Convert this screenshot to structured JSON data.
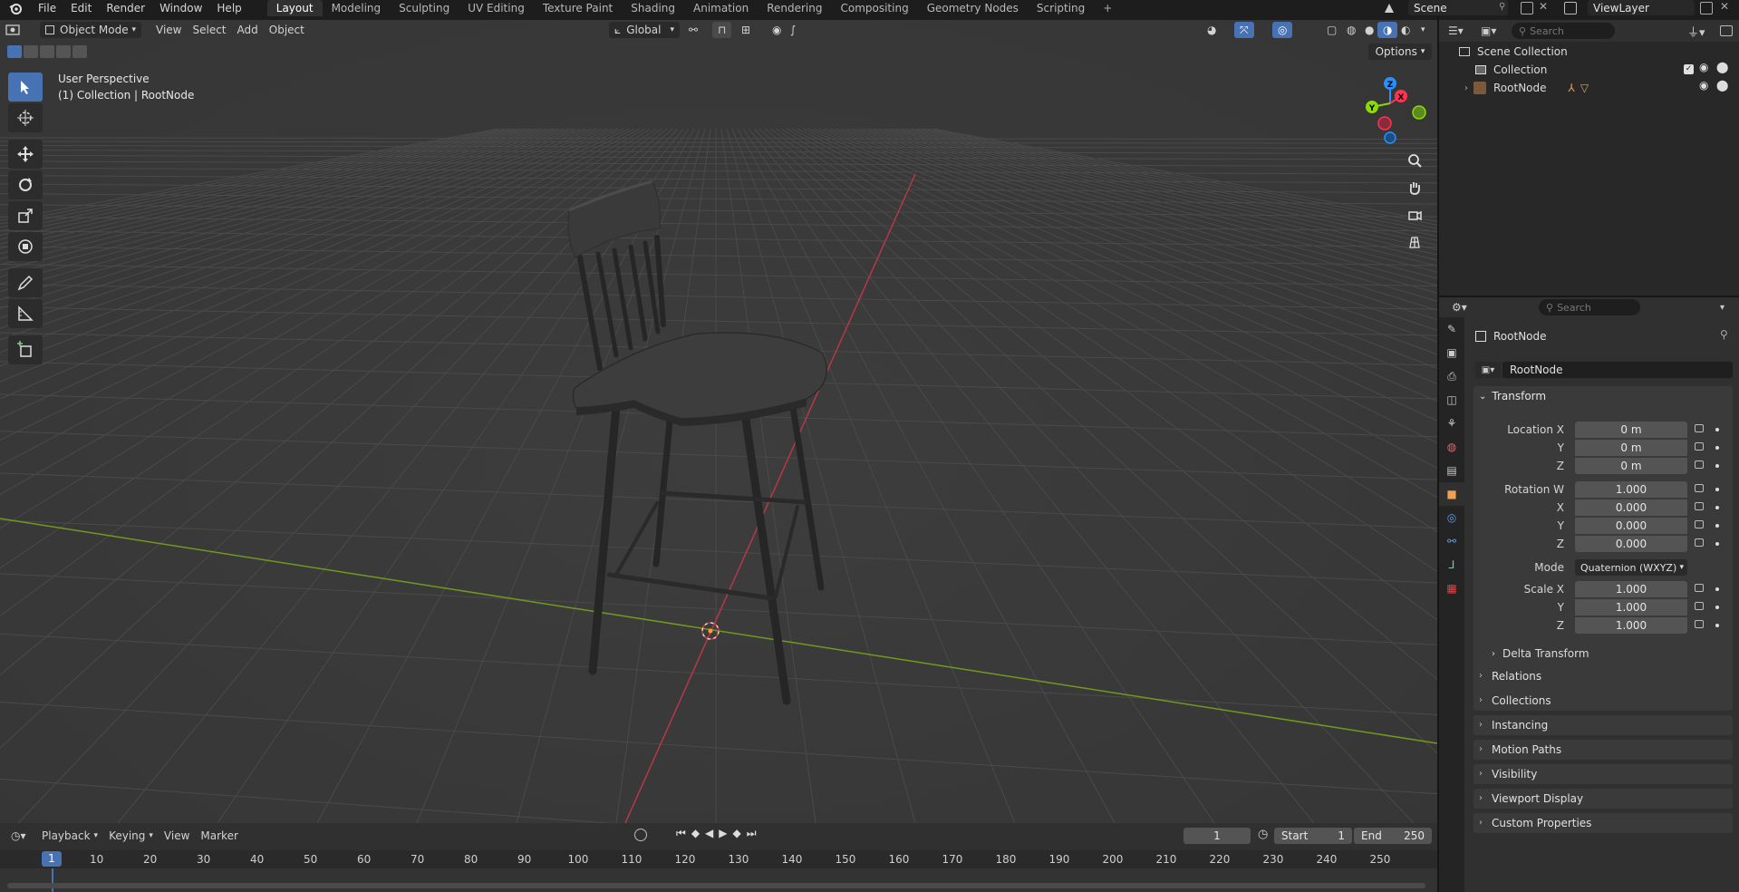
{
  "menu": [
    "File",
    "Edit",
    "Render",
    "Window",
    "Help"
  ],
  "workspaces": [
    "Layout",
    "Modeling",
    "Sculpting",
    "UV Editing",
    "Texture Paint",
    "Shading",
    "Animation",
    "Rendering",
    "Compositing",
    "Geometry Nodes",
    "Scripting",
    "+"
  ],
  "scene_name": "Scene",
  "view_layer_name": "ViewLayer",
  "viewport": {
    "mode": "Object Mode",
    "menus": [
      "View",
      "Select",
      "Add",
      "Object"
    ],
    "orientation": "Global",
    "options_label": "Options",
    "overlay_title": "User Perspective",
    "overlay_subtitle": "(1) Collection | RootNode",
    "gizmo_axes": {
      "x": "X",
      "y": "Y",
      "z": "Z"
    }
  },
  "outliner": {
    "search_placeholder": "Search",
    "rows": [
      {
        "label": "Scene Collection"
      },
      {
        "label": "Collection"
      },
      {
        "label": "RootNode"
      }
    ]
  },
  "properties": {
    "search_placeholder": "Search",
    "object_title": "RootNode",
    "object_name": "RootNode",
    "transform_label": "Transform",
    "location": {
      "label_x": "Location X",
      "label_y": "Y",
      "label_z": "Z",
      "x": "0 m",
      "y": "0 m",
      "z": "0 m"
    },
    "rotation": {
      "label_w": "Rotation W",
      "label_x": "X",
      "label_y": "Y",
      "label_z": "Z",
      "w": "1.000",
      "x": "0.000",
      "y": "0.000",
      "z": "0.000"
    },
    "mode_label": "Mode",
    "mode_value": "Quaternion (WXYZ)",
    "scale": {
      "label_x": "Scale X",
      "label_y": "Y",
      "label_z": "Z",
      "x": "1.000",
      "y": "1.000",
      "z": "1.000"
    },
    "delta_transform": "Delta Transform",
    "panels": [
      "Relations",
      "Collections",
      "Instancing",
      "Motion Paths",
      "Visibility",
      "Viewport Display",
      "Custom Properties"
    ]
  },
  "timeline": {
    "menus": [
      "Playback",
      "Keying",
      "View",
      "Marker"
    ],
    "current_frame": "1",
    "start_label": "Start",
    "start_value": "1",
    "end_label": "End",
    "end_value": "250",
    "ruler_current": "1",
    "ruler_ticks": [
      "10",
      "20",
      "30",
      "40",
      "50",
      "60",
      "70",
      "80",
      "90",
      "100",
      "110",
      "120",
      "130",
      "140",
      "150",
      "160",
      "170",
      "180",
      "190",
      "200",
      "210",
      "220",
      "230",
      "240",
      "250"
    ]
  },
  "colors": {
    "accent": "#4772b3",
    "x_axis": "#ff3352",
    "y_axis": "#8bdc00",
    "z_axis": "#2890ff"
  }
}
